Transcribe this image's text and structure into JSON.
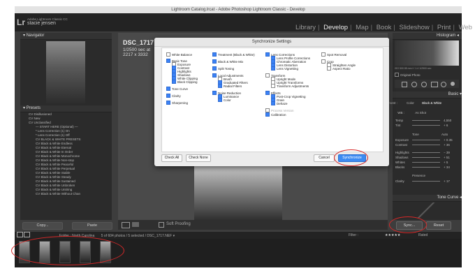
{
  "window": {
    "title": "Lightroom Catalog.lrcat - Adobe Photoshop Lightroom Classic - Develop"
  },
  "identity": {
    "app": "Adobe Lightroom Classic CC",
    "user": "stacie jensen",
    "logo": "Lr"
  },
  "modules": {
    "library": "Library",
    "develop": "Develop",
    "map": "Map",
    "book": "Book",
    "slideshow": "Slideshow",
    "print": "Print",
    "web": "Web"
  },
  "left": {
    "navigator": "Navigator",
    "presets_header": "Presets",
    "presets": [
      "CV Disillusioned",
      "CV New",
      "CV Unclassified",
      "— START HERE (Optional) —",
      "* Lens Correction (1) On",
      "* Lens Correction (1) Off",
      "CV BLACK & WHITE PRESETS",
      "CV Black & White Endless",
      "CV Black & White Eternal",
      "CV Black & White In Order",
      "CV Black & White Monochrome",
      "CV Black & White Non-stop",
      "CV Black & White Peaceful",
      "CV Black & White Perpetual",
      "CV Black & White Stable",
      "CV Black & White Steady",
      "CV Black & White Sustained",
      "CV Black & White Unbroken",
      "CV Black & White Untiring",
      "CV Black & White Without Chan"
    ],
    "copy": "Copy...",
    "paste": "Paste"
  },
  "image_info": {
    "filename": "DSC_1717",
    "exposure": "1/2500 sec at",
    "size": "2217 x 3332"
  },
  "toolbar": {
    "soft_proofing": "Soft Proofing"
  },
  "right": {
    "histogram": "Histogram",
    "hist_values": "ISO 500   85 mm   f / 1.4   1/2500 sec",
    "original_photo": "Original Photo",
    "basic": "Basic",
    "treatment": "Treatment :",
    "color": "Color",
    "bw": "Black & White",
    "wb": "WB :",
    "as_shot": "As Shot",
    "temp": "Temp",
    "temp_val": "4,550",
    "tint": "Tint",
    "tint_val": "+ 6",
    "tone": "Tone",
    "auto": "Auto",
    "exposure": "Exposure",
    "exposure_val": "+ 0.35",
    "contrast": "Contrast",
    "contrast_val": "+ 36",
    "highlights": "Highlights",
    "highlights_val": "− 39",
    "shadows": "Shadows",
    "shadows_val": "+ 51",
    "whites": "Whites",
    "whites_val": "+ 5",
    "blacks": "Blacks",
    "blacks_val": "+ 34",
    "presence": "Presence",
    "clarity": "Clarity",
    "clarity_val": "+ 17",
    "tone_curve": "Tone Curve",
    "sync": "Sync...",
    "reset": "Reset"
  },
  "filmstrip": {
    "folder": "Folder : North Carolina",
    "count": "5 of 604 photos / 5 selected / DSC_1717.NEF ▾",
    "filter": "Filter :",
    "rated": "Rated"
  },
  "dialog": {
    "title": "Synchronize Settings",
    "col1": [
      {
        "label": "White Balance",
        "on": false,
        "indent": 0
      },
      {
        "label": "Basic Tone",
        "on": true,
        "indent": 0
      },
      {
        "label": "Exposure",
        "on": false,
        "indent": 1
      },
      {
        "label": "Contrast",
        "on": true,
        "indent": 1
      },
      {
        "label": "Highlights",
        "on": true,
        "indent": 1
      },
      {
        "label": "Shadows",
        "on": true,
        "indent": 1
      },
      {
        "label": "White Clipping",
        "on": true,
        "indent": 1
      },
      {
        "label": "Black Clipping",
        "on": true,
        "indent": 1
      },
      {
        "label": "Tone Curve",
        "on": true,
        "indent": 0
      },
      {
        "label": "Clarity",
        "on": true,
        "indent": 0
      },
      {
        "label": "Sharpening",
        "on": true,
        "indent": 0
      }
    ],
    "col2": [
      {
        "label": "Treatment (Black & White)",
        "on": true,
        "indent": 0
      },
      {
        "label": "Black & White Mix",
        "on": true,
        "indent": 0
      },
      {
        "label": "Split Toning",
        "on": true,
        "indent": 0
      },
      {
        "label": "Local Adjustments",
        "on": true,
        "indent": 0
      },
      {
        "label": "Brush",
        "on": false,
        "indent": 1
      },
      {
        "label": "Graduated Filters",
        "on": true,
        "indent": 1
      },
      {
        "label": "Radial Filters",
        "on": true,
        "indent": 1
      },
      {
        "label": "Noise Reduction",
        "on": true,
        "indent": 0
      },
      {
        "label": "Luminance",
        "on": true,
        "indent": 1
      },
      {
        "label": "Color",
        "on": true,
        "indent": 1
      }
    ],
    "col3": [
      {
        "label": "Lens Corrections",
        "on": true,
        "indent": 0
      },
      {
        "label": "Lens Profile Corrections",
        "on": true,
        "indent": 1
      },
      {
        "label": "Chromatic Aberration",
        "on": true,
        "indent": 1
      },
      {
        "label": "Lens Distortion",
        "on": true,
        "indent": 1
      },
      {
        "label": "Lens Vignetting",
        "on": true,
        "indent": 1
      },
      {
        "label": "Transform",
        "on": false,
        "indent": 0
      },
      {
        "label": "Upright Mode",
        "on": false,
        "indent": 1
      },
      {
        "label": "Upright Transforms",
        "on": false,
        "indent": 1
      },
      {
        "label": "Transform Adjustments",
        "on": false,
        "indent": 1
      },
      {
        "label": "Effects",
        "on": true,
        "indent": 0
      },
      {
        "label": "Post-Crop Vignetting",
        "on": true,
        "indent": 1
      },
      {
        "label": "Grain",
        "on": true,
        "indent": 1
      },
      {
        "label": "Dehaze",
        "on": true,
        "indent": 1
      },
      {
        "label": "Process Version",
        "on": false,
        "indent": 0,
        "disabled": true
      },
      {
        "label": "Calibration",
        "on": true,
        "indent": 0
      }
    ],
    "col4": [
      {
        "label": "Spot Removal",
        "on": false,
        "indent": 0
      },
      {
        "label": "Crop",
        "on": false,
        "indent": 0
      },
      {
        "label": "Straighten Angle",
        "on": false,
        "indent": 1
      },
      {
        "label": "Aspect Ratio",
        "on": false,
        "indent": 1
      }
    ],
    "check_all": "Check All",
    "check_none": "Check None",
    "cancel": "Cancel",
    "synchronize": "Synchronize"
  },
  "colors": {
    "accent": "#3d8bf2",
    "highlight": "#d62828"
  }
}
